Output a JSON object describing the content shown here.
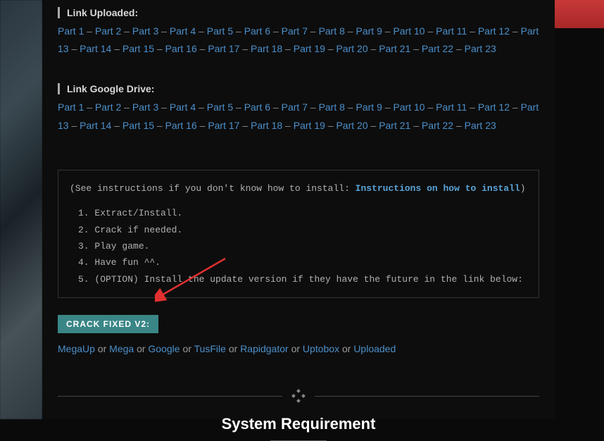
{
  "uploaded": {
    "header": "Link Uploaded:",
    "parts": [
      "Part 1",
      "Part 2",
      "Part 3",
      "Part 4",
      "Part 5",
      "Part 6",
      "Part 7",
      "Part 8",
      "Part 9",
      "Part 10",
      "Part 11",
      "Part 12",
      "Part 13",
      "Part 14",
      "Part 15",
      "Part 16",
      "Part 17",
      "Part 18",
      "Part 19",
      "Part 20",
      "Part 21",
      "Part 22",
      "Part 23"
    ]
  },
  "gdrive": {
    "header": "Link Google Drive:",
    "parts": [
      "Part 1",
      "Part 2",
      "Part 3",
      "Part 4",
      "Part 5",
      "Part 6",
      "Part 7",
      "Part 8",
      "Part 9",
      "Part 10",
      "Part 11",
      "Part 12",
      "Part 13",
      "Part 14",
      "Part 15",
      "Part 16",
      "Part 17",
      "Part 18",
      "Part 19",
      "Part 20",
      "Part 21",
      "Part 22",
      "Part 23"
    ]
  },
  "instructions": {
    "prefix": "(See instructions if you don't know how to install: ",
    "link_text": "Instructions on how to install",
    "suffix": ")",
    "steps": [
      "Extract/Install.",
      "Crack if needed.",
      "Play game.",
      "Have fun ^^.",
      "(OPTION) Install the update version if they have the future in the link below:"
    ]
  },
  "crack": {
    "badge": "CRACK FIXED V2:",
    "links": [
      "MegaUp",
      "Mega",
      "Google",
      "TusFile",
      "Rapidgator",
      "Uptobox",
      "Uploaded"
    ],
    "or": "or"
  },
  "sep": " – ",
  "system_requirement": "System Requirement"
}
